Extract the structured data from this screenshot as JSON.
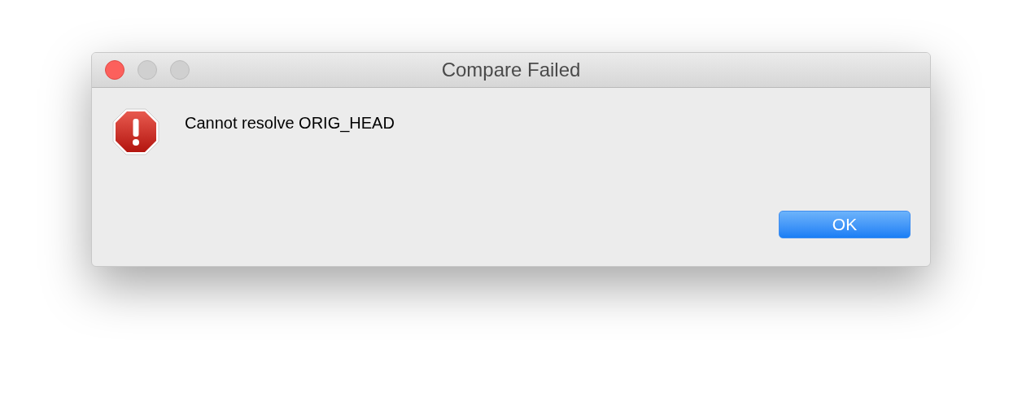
{
  "window": {
    "title": "Compare Failed"
  },
  "message": "Cannot resolve ORIG_HEAD",
  "buttons": [
    {
      "label": "OK",
      "default": true
    }
  ]
}
